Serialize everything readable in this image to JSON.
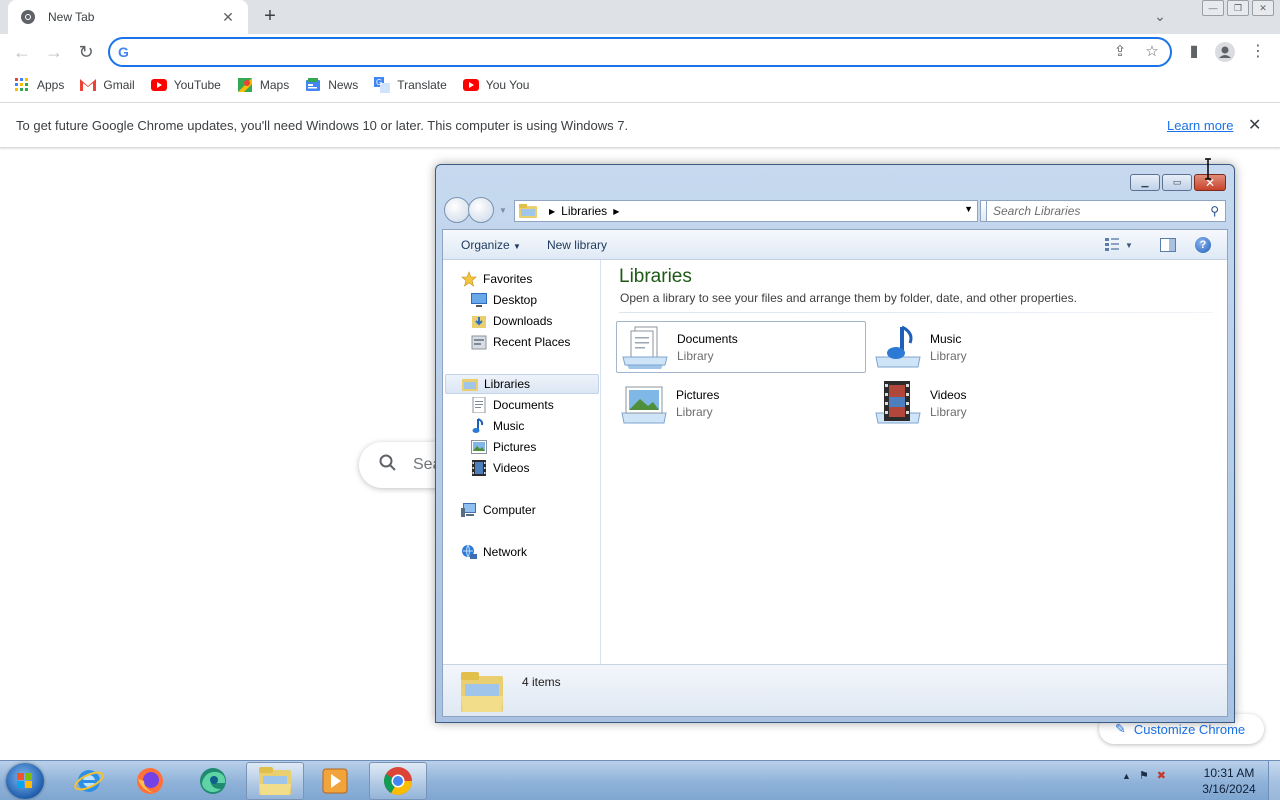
{
  "browser": {
    "tab": {
      "title": "New Tab",
      "close": "✕"
    },
    "new_tab": "+",
    "tab_search": "⌄",
    "window_controls": [
      "—",
      "❐",
      "✕"
    ],
    "nav": {
      "back": "←",
      "forward": "→",
      "reload": "↻"
    },
    "omnibox": {
      "value": "",
      "placeholder": ""
    },
    "bookmarks": [
      {
        "label": "Apps",
        "icon": "apps-grid-icon"
      },
      {
        "label": "Gmail",
        "icon": "gmail-icon"
      },
      {
        "label": "YouTube",
        "icon": "youtube-icon"
      },
      {
        "label": "Maps",
        "icon": "maps-icon"
      },
      {
        "label": "News",
        "icon": "news-icon"
      },
      {
        "label": "Translate",
        "icon": "translate-icon"
      },
      {
        "label": "You You",
        "icon": "youtube-icon"
      }
    ],
    "infobar": {
      "message": "To get future Google Chrome updates, you'll need Windows 10 or later. This computer is using Windows 7.",
      "link": "Learn more",
      "close": "✕"
    }
  },
  "ntp": {
    "search_placeholder": "Sea",
    "customize_label": "Customize Chrome"
  },
  "explorer": {
    "address": {
      "crumb": "Libraries"
    },
    "search_placeholder": "Search Libraries",
    "commands": {
      "organize": "Organize",
      "new_library": "New library"
    },
    "nav_pane": {
      "favorites": {
        "label": "Favorites",
        "children": [
          "Desktop",
          "Downloads",
          "Recent Places"
        ]
      },
      "libraries": {
        "label": "Libraries",
        "children": [
          "Documents",
          "Music",
          "Pictures",
          "Videos"
        ]
      },
      "computer": "Computer",
      "network": "Network"
    },
    "content": {
      "title": "Libraries",
      "description": "Open a library to see your files and arrange them by folder, date, and other properties.",
      "items": [
        {
          "name": "Documents",
          "type": "Library"
        },
        {
          "name": "Music",
          "type": "Library"
        },
        {
          "name": "Pictures",
          "type": "Library"
        },
        {
          "name": "Videos",
          "type": "Library"
        }
      ]
    },
    "status": "4 items"
  },
  "taskbar": {
    "clock": {
      "time": "10:31 AM",
      "date": "3/16/2024"
    },
    "pinned": [
      "internet-explorer-icon",
      "firefox-icon",
      "edge-icon",
      "file-explorer-icon",
      "media-player-icon",
      "chrome-icon"
    ]
  },
  "colors": {
    "chrome_accent": "#1a73e8",
    "tabstrip_bg": "#dee1e6",
    "library_title": "#1e5a16",
    "taskbar": "#8fb2d9"
  }
}
